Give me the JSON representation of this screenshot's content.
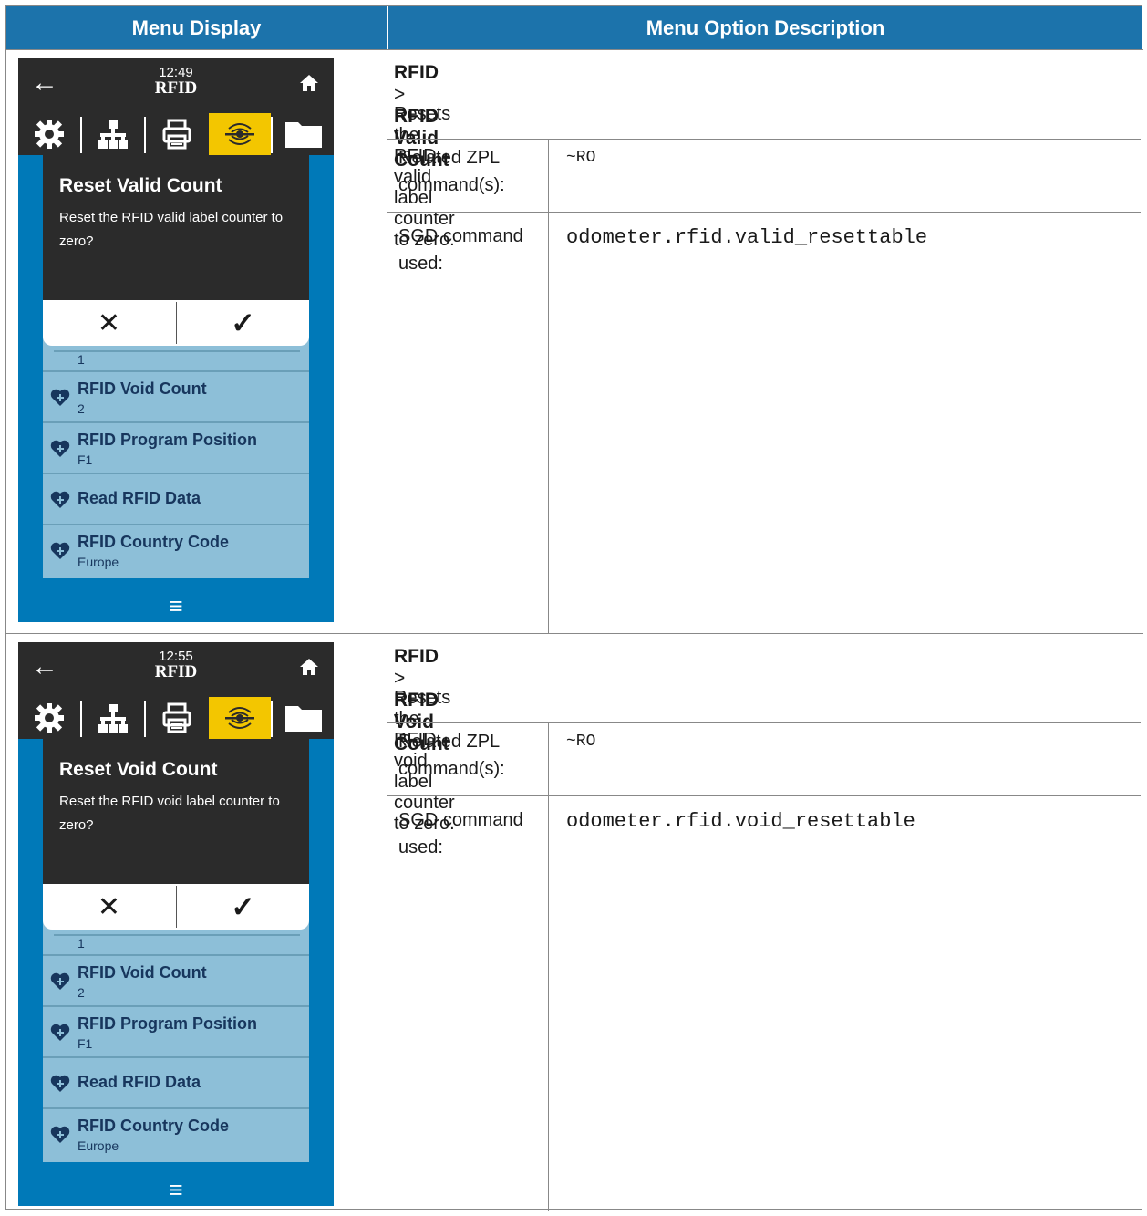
{
  "header": {
    "col1": "Menu Display",
    "col2": "Menu Option Description"
  },
  "rows": [
    {
      "screen": {
        "time": "12:49",
        "title": "RFID",
        "dialog_title": "Reset Valid Count",
        "dialog_msg": "Reset the RFID valid label counter to zero?",
        "cancel": "✕",
        "ok": "✓",
        "partial_value": "1",
        "items": [
          {
            "label": "RFID Void Count",
            "value": "2"
          },
          {
            "label": "RFID Program Position",
            "value": "F1"
          },
          {
            "label": "Read RFID Data",
            "value": ""
          },
          {
            "label": "RFID Country Code",
            "value": "Europe"
          }
        ],
        "menu": "≡"
      },
      "desc": {
        "crumb1": "RFID",
        "sep": " > ",
        "crumb2": "RFID Valid Count",
        "summary": "Resets the RFID valid label counter to zero.",
        "zpl_label": "Related ZPL command(s):",
        "zpl": "~RO",
        "sgd_label": "SGD command used:",
        "sgd": "odometer.rfid.valid_resettable"
      }
    },
    {
      "screen": {
        "time": "12:55",
        "title": "RFID",
        "dialog_title": "Reset Void Count",
        "dialog_msg": "Reset the RFID void label counter to zero?",
        "cancel": "✕",
        "ok": "✓",
        "partial_value": "1",
        "items": [
          {
            "label": "RFID Void Count",
            "value": "2"
          },
          {
            "label": "RFID Program Position",
            "value": "F1"
          },
          {
            "label": "Read RFID Data",
            "value": ""
          },
          {
            "label": "RFID Country Code",
            "value": "Europe"
          }
        ],
        "menu": "≡"
      },
      "desc": {
        "crumb1": "RFID",
        "sep": " > ",
        "crumb2": "RFID Void Count",
        "summary": "Resets the RFID void label counter to zero.",
        "zpl_label": "Related ZPL command(s):",
        "zpl": "~RO",
        "sgd_label": "SGD command used:",
        "sgd": "odometer.rfid.void_resettable"
      }
    }
  ],
  "colors": {
    "header_bg": "#1c73ab",
    "screen_bg": "#0079b8",
    "selected_tab": "#f3c600",
    "list_bg": "#8dbfd8"
  }
}
